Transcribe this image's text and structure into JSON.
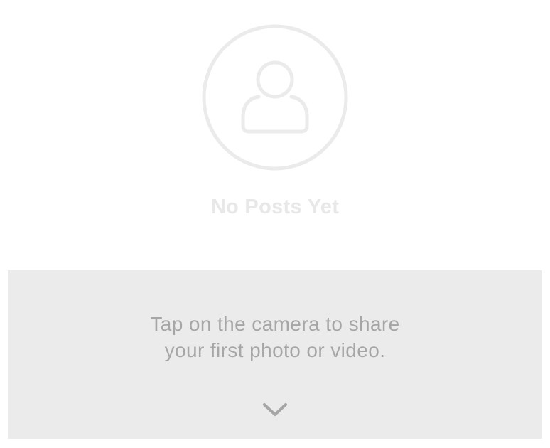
{
  "empty_state": {
    "icon": "user-avatar-icon",
    "title": "No Posts Yet"
  },
  "hint": {
    "lines": [
      "Tap on the camera to share",
      "your first photo or video."
    ],
    "expand_icon": "chevron-down-icon"
  },
  "colors": {
    "icon_stroke": "#ebebeb",
    "title_text": "#e8e8e8",
    "panel_background": "#ebebeb",
    "hint_text": "#a6a6a6",
    "chevron": "#a6a6a6"
  }
}
